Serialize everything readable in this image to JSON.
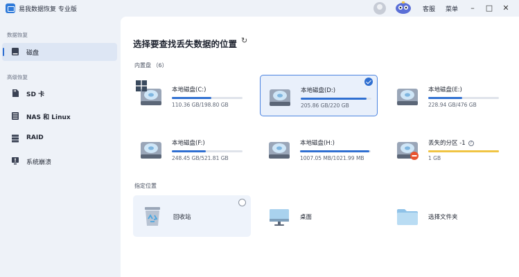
{
  "app": {
    "title": "易我数据恢复 专业版"
  },
  "titlebar": {
    "support_label": "客服",
    "menu_label": "菜单"
  },
  "sidebar": {
    "section1": "数据恢复",
    "section2": "高级恢复",
    "items": [
      {
        "label": "磁盘",
        "icon": "disk-icon"
      },
      {
        "label": "SD 卡",
        "icon": "sd-card-icon"
      },
      {
        "label": "NAS 和 Linux",
        "icon": "nas-icon"
      },
      {
        "label": "RAID",
        "icon": "raid-icon"
      },
      {
        "label": "系统崩溃",
        "icon": "system-crash-icon"
      }
    ]
  },
  "main": {
    "title": "选择要查找丢失数据的位置",
    "internal_label": "内置盘 （6）",
    "drives": [
      {
        "name": "本地磁盘(C:)",
        "size": "110.36 GB/198.80 GB",
        "used_fraction": 0.555,
        "system": true
      },
      {
        "name": "本地磁盘(D:)",
        "size": "205.86 GB/220 GB",
        "used_fraction": 0.936,
        "selected": true
      },
      {
        "name": "本地磁盘(E:)",
        "size": "228.94 GB/476 GB",
        "used_fraction": 0.481
      },
      {
        "name": "本地磁盘(F:)",
        "size": "248.45 GB/521.81 GB",
        "used_fraction": 0.476
      },
      {
        "name": "本地磁盘(H:)",
        "size": "1007.05 MB/1021.99 MB",
        "used_fraction": 0.985
      },
      {
        "name": "丢失的分区 -1",
        "size": "1 GB",
        "used_fraction": 1.0,
        "lost": true
      }
    ],
    "location_label": "指定位置",
    "locations": [
      {
        "name": "回收站",
        "icon": "recycle-bin-icon"
      },
      {
        "name": "桌面",
        "icon": "desktop-icon"
      },
      {
        "name": "选择文件夹",
        "icon": "folder-icon"
      }
    ]
  },
  "colors": {
    "accent": "#2f6fd1",
    "warning": "#f0c443",
    "danger": "#e8532f",
    "background": "#eef2f8"
  }
}
